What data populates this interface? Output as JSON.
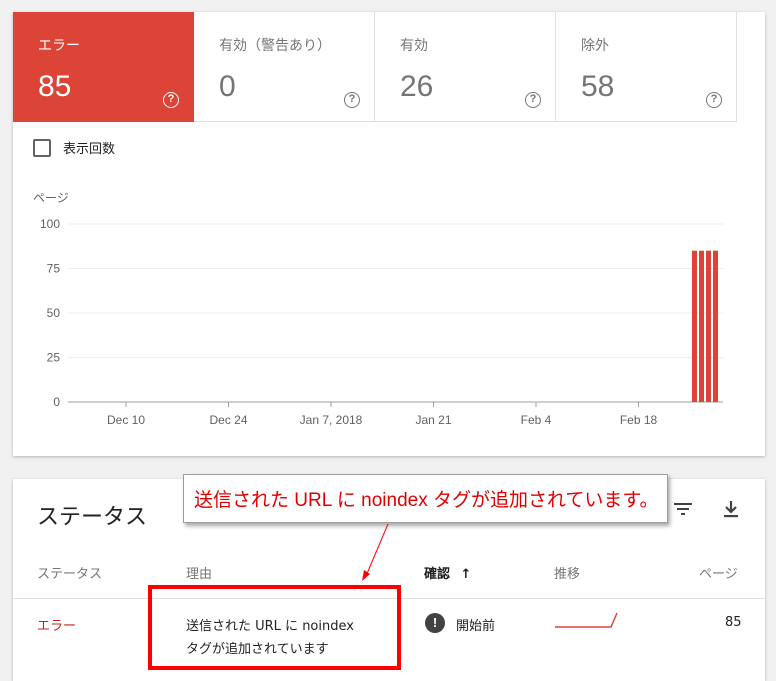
{
  "tiles": [
    {
      "label": "エラー",
      "value": "85",
      "active": true
    },
    {
      "label": "有効（警告あり）",
      "value": "0",
      "active": false
    },
    {
      "label": "有効",
      "value": "26",
      "active": false
    },
    {
      "label": "除外",
      "value": "58",
      "active": false
    }
  ],
  "help_glyph": "?",
  "impressions_label": "表示回数",
  "chart_data": {
    "type": "bar",
    "ylabel": "ページ",
    "ylim": [
      0,
      100
    ],
    "yticks": [
      "100",
      "75",
      "50",
      "25",
      "0"
    ],
    "xticks": [
      "Dec 10",
      "Dec 24",
      "Jan 7, 2018",
      "Jan 21",
      "Feb 4",
      "Feb 18"
    ],
    "series": [
      {
        "values": [
          85,
          85,
          85,
          85
        ]
      }
    ],
    "bar_color": "#db4437",
    "grid": true
  },
  "status": {
    "title": "ステータス",
    "filter_icon": "filter-icon",
    "download_icon": "download-icon",
    "columns": {
      "status": "ステータス",
      "reason": "理由",
      "validation": "確認",
      "sort_arrow": "↑",
      "trend": "推移",
      "pages": "ページ"
    },
    "row": {
      "status": "エラー",
      "reason_line1": "送信された URL に noindex",
      "reason_line2": "タグが追加されています",
      "validation_icon": "!",
      "validation": "開始前",
      "pages": "85"
    }
  },
  "annotation": {
    "callout_text": "送信された URL に noindex タグが追加されています。",
    "color": "#ff0000"
  }
}
